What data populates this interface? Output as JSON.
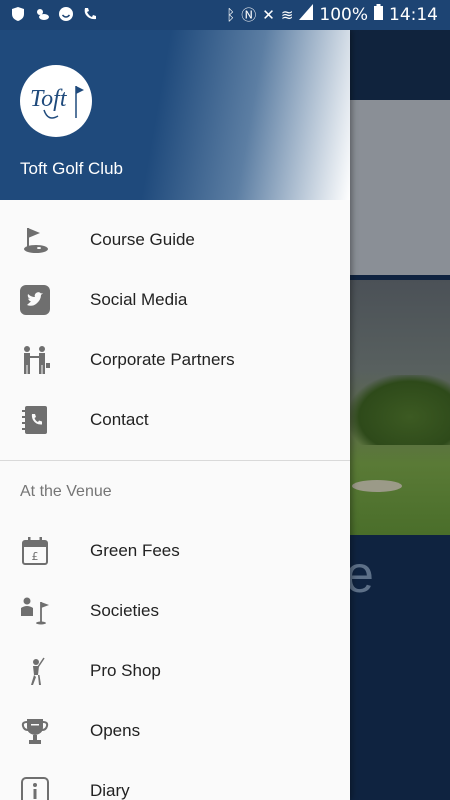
{
  "status_bar": {
    "battery": "100%",
    "time": "14:14"
  },
  "drawer": {
    "club_name": "Toft Golf Club",
    "main_items": [
      {
        "label": "Course Guide",
        "icon": "golf-flag-icon"
      },
      {
        "label": "Social Media",
        "icon": "twitter-icon"
      },
      {
        "label": "Corporate Partners",
        "icon": "handshake-icon"
      },
      {
        "label": "Contact",
        "icon": "phone-book-icon"
      }
    ],
    "section_title": "At the Venue",
    "venue_items": [
      {
        "label": "Green Fees",
        "icon": "calendar-pound-icon"
      },
      {
        "label": "Societies",
        "icon": "society-golfer-icon"
      },
      {
        "label": "Pro Shop",
        "icon": "golfer-swing-icon"
      },
      {
        "label": "Opens",
        "icon": "trophy-icon"
      },
      {
        "label": "Diary",
        "icon": "info-icon"
      }
    ]
  },
  "background": {
    "partial_text": "e"
  },
  "colors": {
    "header_blue": "#1f4a7c",
    "icon_grey": "#6f6f6f"
  }
}
